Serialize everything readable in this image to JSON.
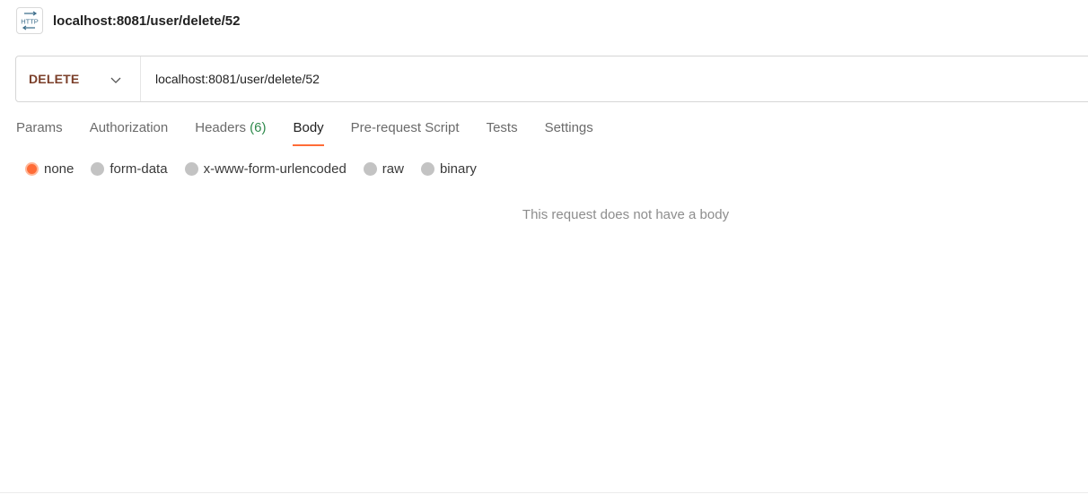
{
  "header": {
    "icon": "http-icon",
    "icon_text": "HTTP",
    "title": "localhost:8081/user/delete/52"
  },
  "request": {
    "method": "DELETE",
    "method_color": "#7b3f2a",
    "url": "localhost:8081/user/delete/52"
  },
  "tabs": [
    {
      "label": "Params",
      "count": ""
    },
    {
      "label": "Authorization",
      "count": ""
    },
    {
      "label": "Headers",
      "count": "(6)"
    },
    {
      "label": "Body",
      "count": "",
      "active": true
    },
    {
      "label": "Pre-request Script",
      "count": ""
    },
    {
      "label": "Tests",
      "count": ""
    },
    {
      "label": "Settings",
      "count": ""
    }
  ],
  "body_options": [
    {
      "label": "none",
      "selected": true
    },
    {
      "label": "form-data",
      "selected": false
    },
    {
      "label": "x-www-form-urlencoded",
      "selected": false
    },
    {
      "label": "raw",
      "selected": false
    },
    {
      "label": "binary",
      "selected": false
    }
  ],
  "empty_body_message": "This request does not have a body",
  "colors": {
    "accent": "#ff6c37",
    "count_green": "#2f8a4c"
  }
}
